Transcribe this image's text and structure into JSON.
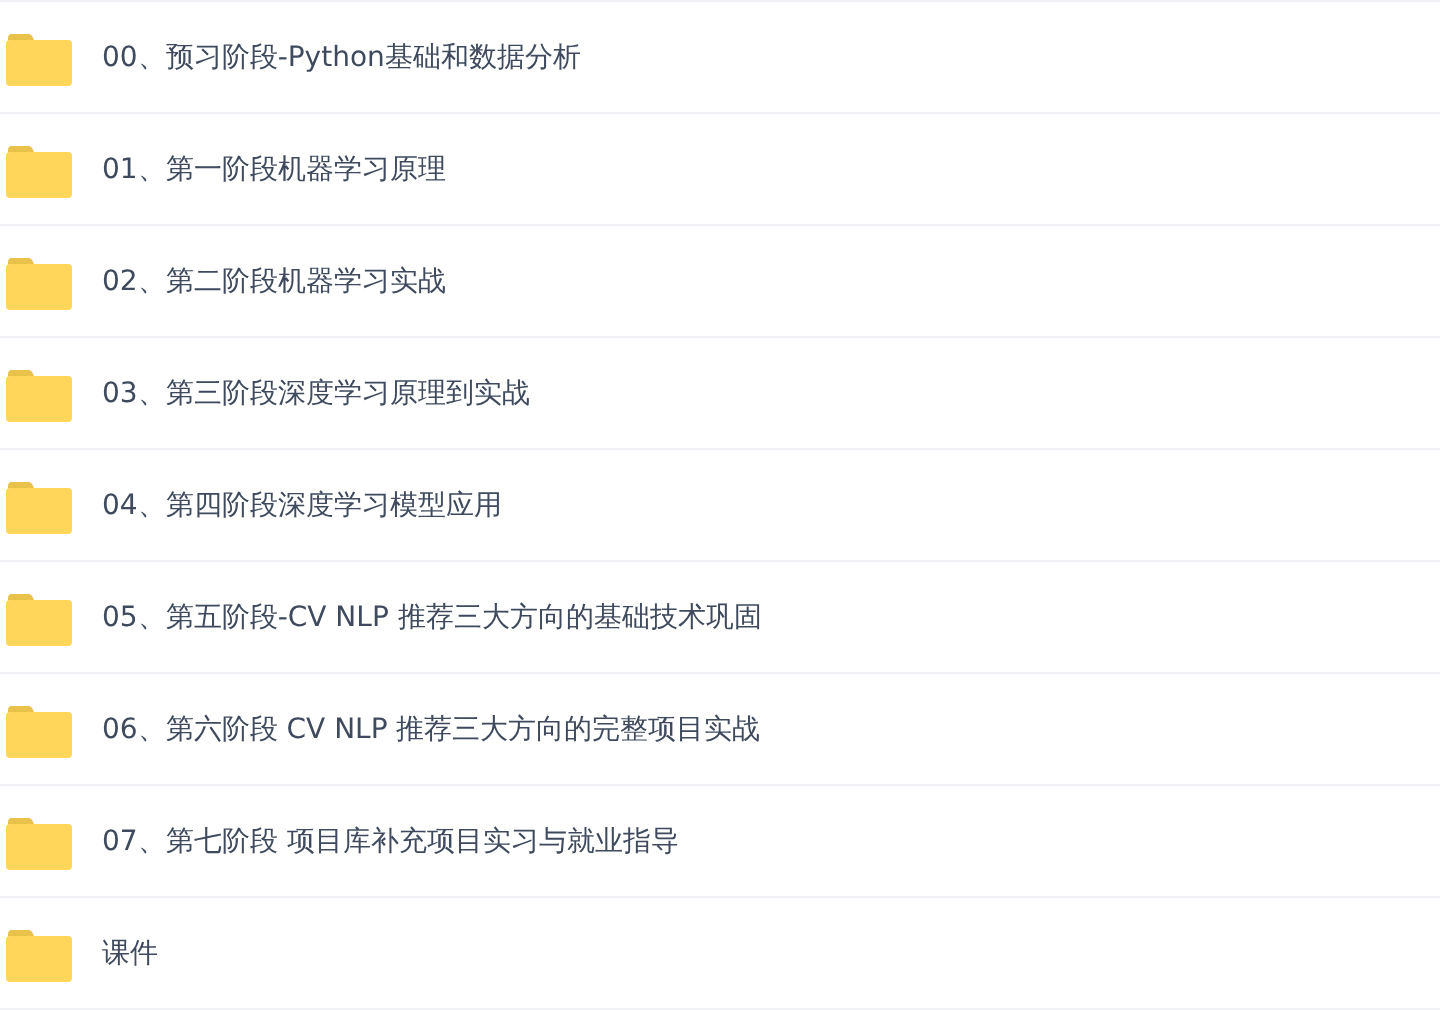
{
  "files": [
    {
      "name": "00、预习阶段-Python基础和数据分析"
    },
    {
      "name": "01、第一阶段机器学习原理"
    },
    {
      "name": "02、第二阶段机器学习实战"
    },
    {
      "name": "03、第三阶段深度学习原理到实战"
    },
    {
      "name": "04、第四阶段深度学习模型应用"
    },
    {
      "name": "05、第五阶段-CV NLP 推荐三大方向的基础技术巩固"
    },
    {
      "name": "06、第六阶段 CV NLP 推荐三大方向的完整项目实战"
    },
    {
      "name": "07、第七阶段 项目库补充项目实习与就业指导"
    },
    {
      "name": "课件"
    }
  ]
}
